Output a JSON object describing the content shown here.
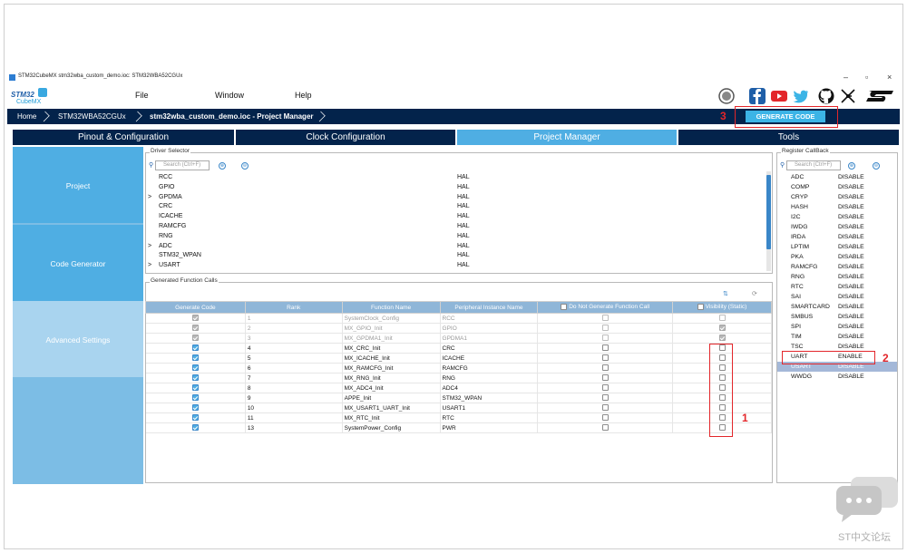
{
  "window": {
    "title": "STM32CubeMX stm32wba_custom_demo.ioc: STM32WBA52CGUx",
    "controls": [
      "–",
      "▫",
      "×"
    ]
  },
  "logo": {
    "line1": "STM32",
    "line2": "CubeMX"
  },
  "menu": {
    "file": "File",
    "window": "Window",
    "help": "Help"
  },
  "breadcrumb": {
    "home": "Home",
    "mcu": "STM32WBA52CGUx",
    "project": "stm32wba_custom_demo.ioc - Project Manager"
  },
  "generate_button": "GENERATE CODE",
  "tabs": [
    "Pinout & Configuration",
    "Clock Configuration",
    "Project Manager",
    "Tools"
  ],
  "sidebar": [
    "Project",
    "Code Generator",
    "Advanced Settings"
  ],
  "driver_selector": {
    "title": "Driver Selector",
    "search_placeholder": "Search (Ctrl+F)",
    "rows": [
      {
        "arrow": "",
        "name": "RCC",
        "value": "HAL"
      },
      {
        "arrow": "",
        "name": "GPIO",
        "value": "HAL"
      },
      {
        "arrow": ">",
        "name": "GPDMA",
        "value": "HAL"
      },
      {
        "arrow": "",
        "name": "CRC",
        "value": "HAL"
      },
      {
        "arrow": "",
        "name": "ICACHE",
        "value": "HAL"
      },
      {
        "arrow": "",
        "name": "RAMCFG",
        "value": "HAL"
      },
      {
        "arrow": "",
        "name": "RNG",
        "value": "HAL"
      },
      {
        "arrow": ">",
        "name": "ADC",
        "value": "HAL"
      },
      {
        "arrow": "",
        "name": "STM32_WPAN",
        "value": "HAL"
      },
      {
        "arrow": ">",
        "name": "USART",
        "value": "HAL"
      }
    ]
  },
  "generated_calls": {
    "title": "Generated Function Calls",
    "headers": [
      "Generate Code",
      "Rank",
      "Function Name",
      "Peripheral Instance Name",
      "Do Not Generate Function Call",
      "Visibility (Static)"
    ],
    "rows": [
      {
        "rank": "1",
        "func": "SystemClock_Config",
        "periph": "RCC",
        "disabled": true,
        "vis": "empty"
      },
      {
        "rank": "2",
        "func": "MX_GPIO_Init",
        "periph": "GPIO",
        "disabled": true,
        "vis": "grey"
      },
      {
        "rank": "3",
        "func": "MX_GPDMA1_Init",
        "periph": "GPDMA1",
        "disabled": true,
        "vis": "grey"
      },
      {
        "rank": "4",
        "func": "MX_CRC_Init",
        "periph": "CRC",
        "disabled": false,
        "vis": "empty"
      },
      {
        "rank": "5",
        "func": "MX_ICACHE_Init",
        "periph": "ICACHE",
        "disabled": false,
        "vis": "empty"
      },
      {
        "rank": "6",
        "func": "MX_RAMCFG_Init",
        "periph": "RAMCFG",
        "disabled": false,
        "vis": "empty"
      },
      {
        "rank": "7",
        "func": "MX_RNG_Init",
        "periph": "RNG",
        "disabled": false,
        "vis": "empty"
      },
      {
        "rank": "8",
        "func": "MX_ADC4_Init",
        "periph": "ADC4",
        "disabled": false,
        "vis": "empty"
      },
      {
        "rank": "9",
        "func": "APPE_Init",
        "periph": "STM32_WPAN",
        "disabled": false,
        "vis": "empty"
      },
      {
        "rank": "10",
        "func": "MX_USART1_UART_Init",
        "periph": "USART1",
        "disabled": false,
        "vis": "empty"
      },
      {
        "rank": "11",
        "func": "MX_RTC_Init",
        "periph": "RTC",
        "disabled": false,
        "vis": "empty"
      },
      {
        "rank": "13",
        "func": "SystemPower_Config",
        "periph": "PWR",
        "disabled": false,
        "vis": "empty"
      }
    ]
  },
  "register_callback": {
    "title": "Register CallBack",
    "search_placeholder": "Search (Ctrl+F)",
    "rows": [
      {
        "name": "ADC",
        "value": "DISABLE"
      },
      {
        "name": "COMP",
        "value": "DISABLE"
      },
      {
        "name": "CRYP",
        "value": "DISABLE"
      },
      {
        "name": "HASH",
        "value": "DISABLE"
      },
      {
        "name": "I2C",
        "value": "DISABLE"
      },
      {
        "name": "IWDG",
        "value": "DISABLE"
      },
      {
        "name": "IRDA",
        "value": "DISABLE"
      },
      {
        "name": "LPTIM",
        "value": "DISABLE"
      },
      {
        "name": "PKA",
        "value": "DISABLE"
      },
      {
        "name": "RAMCFG",
        "value": "DISABLE"
      },
      {
        "name": "RNG",
        "value": "DISABLE"
      },
      {
        "name": "RTC",
        "value": "DISABLE"
      },
      {
        "name": "SAI",
        "value": "DISABLE"
      },
      {
        "name": "SMARTCARD",
        "value": "DISABLE"
      },
      {
        "name": "SMBUS",
        "value": "DISABLE"
      },
      {
        "name": "SPI",
        "value": "DISABLE"
      },
      {
        "name": "TIM",
        "value": "DISABLE"
      },
      {
        "name": "TSC",
        "value": "DISABLE"
      },
      {
        "name": "UART",
        "value": "ENABLE"
      },
      {
        "name": "USART",
        "value": "DISABLE"
      },
      {
        "name": "WWDG",
        "value": "DISABLE"
      }
    ]
  },
  "annotations": {
    "n1": "1",
    "n2": "2",
    "n3": "3"
  },
  "watermark": "ST中文论坛",
  "colors": {
    "nav": "#03234b",
    "accent": "#4faee3",
    "highlight": "#e3262a",
    "generate": "#3cb4e6"
  }
}
